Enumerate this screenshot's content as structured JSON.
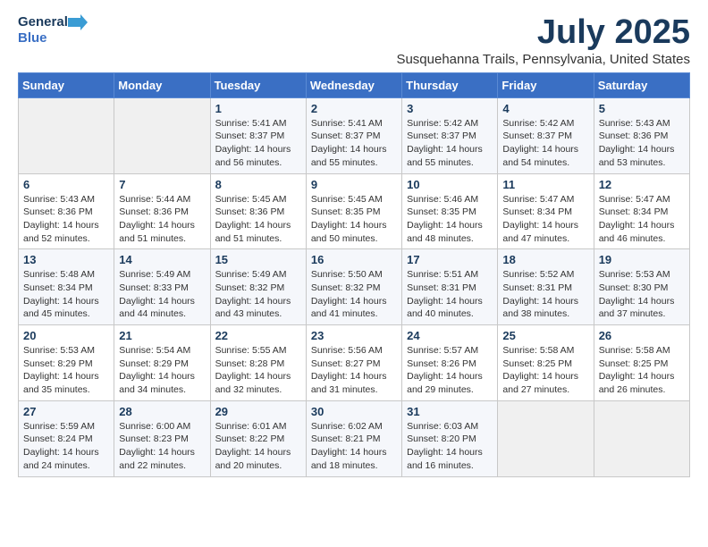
{
  "logo": {
    "line1": "General",
    "line2": "Blue"
  },
  "title": "July 2025",
  "subtitle": "Susquehanna Trails, Pennsylvania, United States",
  "weekdays": [
    "Sunday",
    "Monday",
    "Tuesday",
    "Wednesday",
    "Thursday",
    "Friday",
    "Saturday"
  ],
  "weeks": [
    [
      {
        "day": "",
        "detail": ""
      },
      {
        "day": "",
        "detail": ""
      },
      {
        "day": "1",
        "detail": "Sunrise: 5:41 AM\nSunset: 8:37 PM\nDaylight: 14 hours and 56 minutes."
      },
      {
        "day": "2",
        "detail": "Sunrise: 5:41 AM\nSunset: 8:37 PM\nDaylight: 14 hours and 55 minutes."
      },
      {
        "day": "3",
        "detail": "Sunrise: 5:42 AM\nSunset: 8:37 PM\nDaylight: 14 hours and 55 minutes."
      },
      {
        "day": "4",
        "detail": "Sunrise: 5:42 AM\nSunset: 8:37 PM\nDaylight: 14 hours and 54 minutes."
      },
      {
        "day": "5",
        "detail": "Sunrise: 5:43 AM\nSunset: 8:36 PM\nDaylight: 14 hours and 53 minutes."
      }
    ],
    [
      {
        "day": "6",
        "detail": "Sunrise: 5:43 AM\nSunset: 8:36 PM\nDaylight: 14 hours and 52 minutes."
      },
      {
        "day": "7",
        "detail": "Sunrise: 5:44 AM\nSunset: 8:36 PM\nDaylight: 14 hours and 51 minutes."
      },
      {
        "day": "8",
        "detail": "Sunrise: 5:45 AM\nSunset: 8:36 PM\nDaylight: 14 hours and 51 minutes."
      },
      {
        "day": "9",
        "detail": "Sunrise: 5:45 AM\nSunset: 8:35 PM\nDaylight: 14 hours and 50 minutes."
      },
      {
        "day": "10",
        "detail": "Sunrise: 5:46 AM\nSunset: 8:35 PM\nDaylight: 14 hours and 48 minutes."
      },
      {
        "day": "11",
        "detail": "Sunrise: 5:47 AM\nSunset: 8:34 PM\nDaylight: 14 hours and 47 minutes."
      },
      {
        "day": "12",
        "detail": "Sunrise: 5:47 AM\nSunset: 8:34 PM\nDaylight: 14 hours and 46 minutes."
      }
    ],
    [
      {
        "day": "13",
        "detail": "Sunrise: 5:48 AM\nSunset: 8:34 PM\nDaylight: 14 hours and 45 minutes."
      },
      {
        "day": "14",
        "detail": "Sunrise: 5:49 AM\nSunset: 8:33 PM\nDaylight: 14 hours and 44 minutes."
      },
      {
        "day": "15",
        "detail": "Sunrise: 5:49 AM\nSunset: 8:32 PM\nDaylight: 14 hours and 43 minutes."
      },
      {
        "day": "16",
        "detail": "Sunrise: 5:50 AM\nSunset: 8:32 PM\nDaylight: 14 hours and 41 minutes."
      },
      {
        "day": "17",
        "detail": "Sunrise: 5:51 AM\nSunset: 8:31 PM\nDaylight: 14 hours and 40 minutes."
      },
      {
        "day": "18",
        "detail": "Sunrise: 5:52 AM\nSunset: 8:31 PM\nDaylight: 14 hours and 38 minutes."
      },
      {
        "day": "19",
        "detail": "Sunrise: 5:53 AM\nSunset: 8:30 PM\nDaylight: 14 hours and 37 minutes."
      }
    ],
    [
      {
        "day": "20",
        "detail": "Sunrise: 5:53 AM\nSunset: 8:29 PM\nDaylight: 14 hours and 35 minutes."
      },
      {
        "day": "21",
        "detail": "Sunrise: 5:54 AM\nSunset: 8:29 PM\nDaylight: 14 hours and 34 minutes."
      },
      {
        "day": "22",
        "detail": "Sunrise: 5:55 AM\nSunset: 8:28 PM\nDaylight: 14 hours and 32 minutes."
      },
      {
        "day": "23",
        "detail": "Sunrise: 5:56 AM\nSunset: 8:27 PM\nDaylight: 14 hours and 31 minutes."
      },
      {
        "day": "24",
        "detail": "Sunrise: 5:57 AM\nSunset: 8:26 PM\nDaylight: 14 hours and 29 minutes."
      },
      {
        "day": "25",
        "detail": "Sunrise: 5:58 AM\nSunset: 8:25 PM\nDaylight: 14 hours and 27 minutes."
      },
      {
        "day": "26",
        "detail": "Sunrise: 5:58 AM\nSunset: 8:25 PM\nDaylight: 14 hours and 26 minutes."
      }
    ],
    [
      {
        "day": "27",
        "detail": "Sunrise: 5:59 AM\nSunset: 8:24 PM\nDaylight: 14 hours and 24 minutes."
      },
      {
        "day": "28",
        "detail": "Sunrise: 6:00 AM\nSunset: 8:23 PM\nDaylight: 14 hours and 22 minutes."
      },
      {
        "day": "29",
        "detail": "Sunrise: 6:01 AM\nSunset: 8:22 PM\nDaylight: 14 hours and 20 minutes."
      },
      {
        "day": "30",
        "detail": "Sunrise: 6:02 AM\nSunset: 8:21 PM\nDaylight: 14 hours and 18 minutes."
      },
      {
        "day": "31",
        "detail": "Sunrise: 6:03 AM\nSunset: 8:20 PM\nDaylight: 14 hours and 16 minutes."
      },
      {
        "day": "",
        "detail": ""
      },
      {
        "day": "",
        "detail": ""
      }
    ]
  ]
}
